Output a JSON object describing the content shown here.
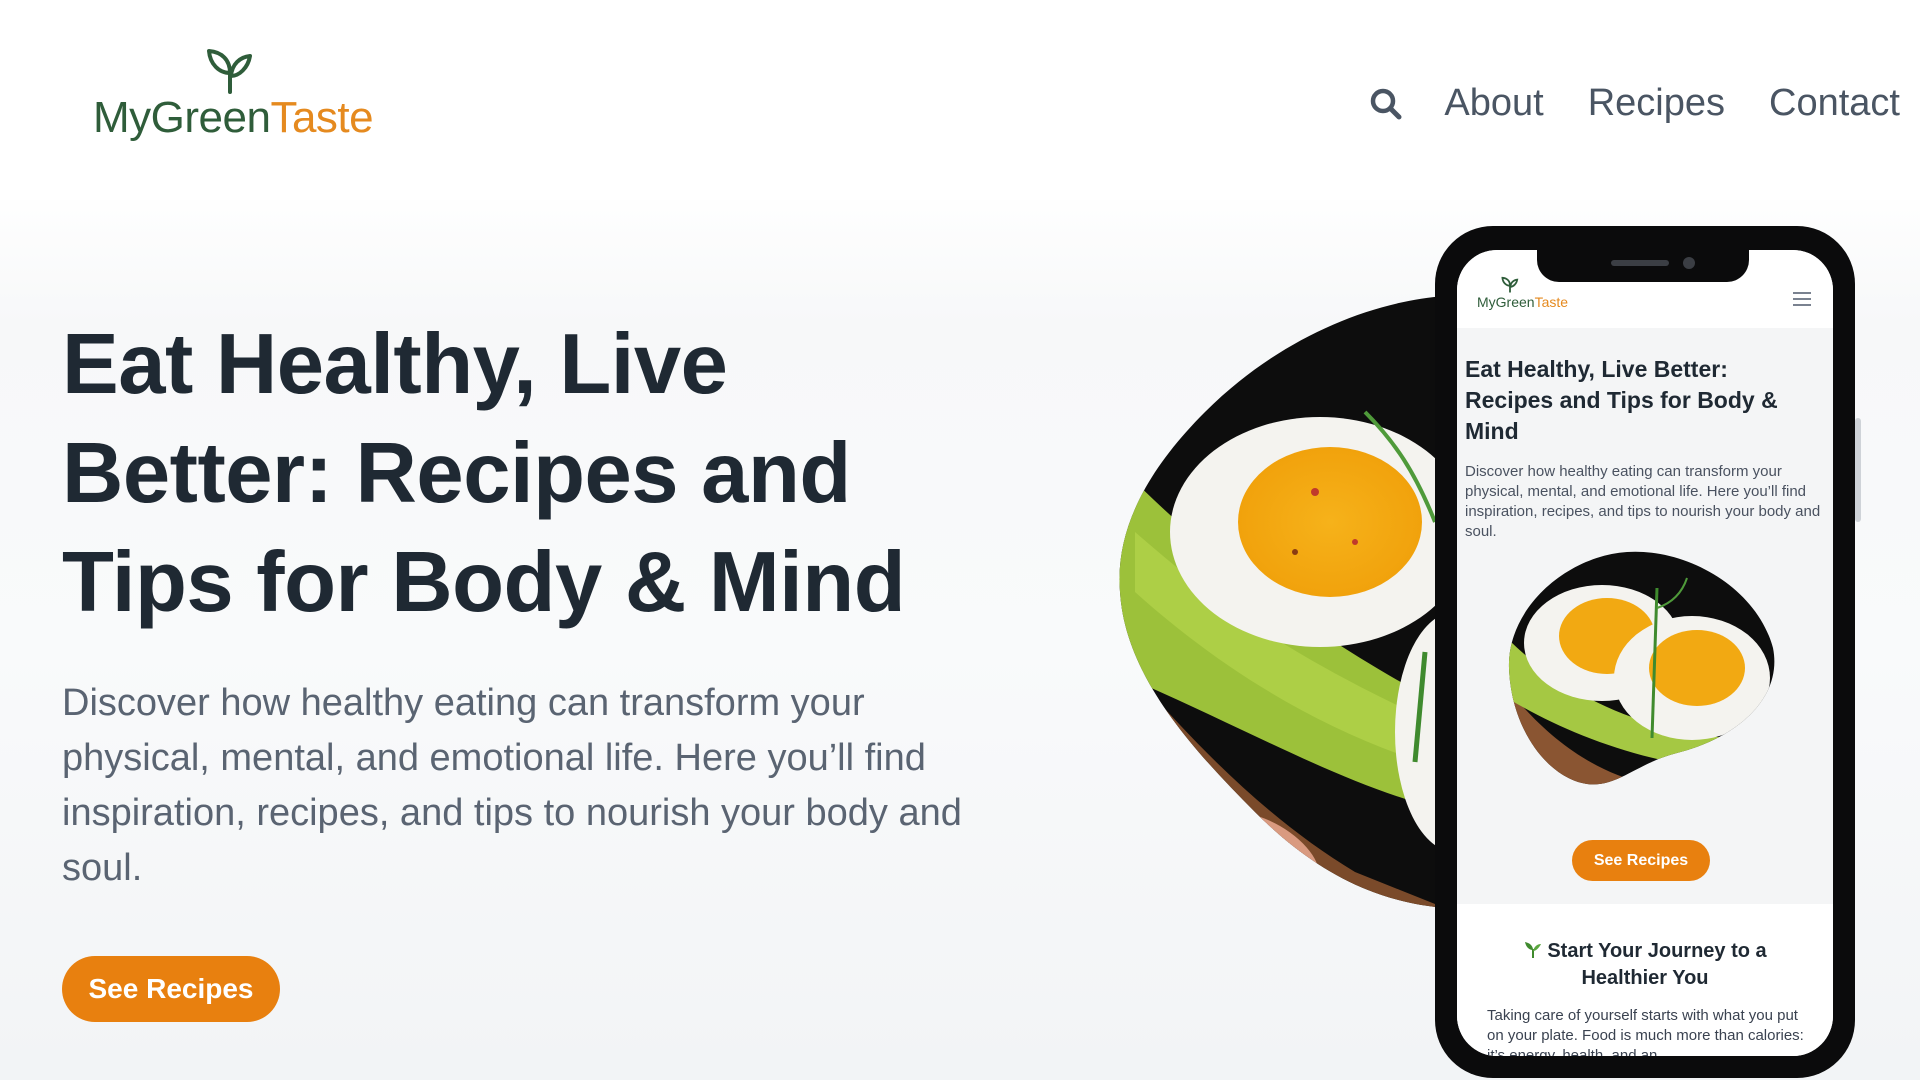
{
  "brand": {
    "name_part1": "MyGreen",
    "name_part2": "Taste"
  },
  "nav": {
    "search_icon": "search-icon",
    "items": [
      {
        "label": "About"
      },
      {
        "label": "Recipes"
      },
      {
        "label": "Contact"
      }
    ]
  },
  "hero": {
    "title": "Eat Healthy, Live Better: Recipes and Tips for Body & Mind",
    "subtitle": "Discover how healthy eating can transform your physical, mental, and emotional life. Here you’ll find inspiration, recipes, and tips to nourish your body and soul.",
    "cta_label": "See Recipes"
  },
  "mobile": {
    "brand": {
      "name_part1": "MyGreen",
      "name_part2": "Taste"
    },
    "menu_icon": "hamburger-menu-icon",
    "title": "Eat Healthy, Live Better: Recipes and Tips for Body & Mind",
    "subtitle": "Discover how healthy eating can transform your physical, mental, and emotional life. Here you’ll find inspiration, recipes, and tips to nourish your body and soul.",
    "cta_label": "See Recipes",
    "section": {
      "title": "Start Your Journey to a Healthier You",
      "text": "Taking care of yourself starts with what you put on your plate. Food is much more than calories: it’s energy, health, and an"
    }
  },
  "colors": {
    "brand_green": "#2f5d3a",
    "brand_orange": "#e58a1f",
    "cta_orange": "#e8800f",
    "heading": "#1f2933",
    "body_text": "#5a6472"
  }
}
